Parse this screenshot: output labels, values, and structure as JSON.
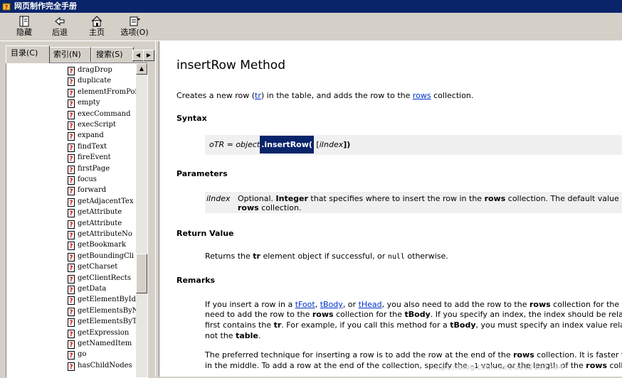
{
  "window": {
    "title": "网页制作完全手册"
  },
  "toolbar": {
    "buttons": [
      {
        "id": "hide",
        "label": "隐藏",
        "icon": "hide-pane-icon"
      },
      {
        "id": "back",
        "label": "后退",
        "icon": "back-arrow-icon"
      },
      {
        "id": "home",
        "label": "主页",
        "icon": "home-icon"
      },
      {
        "id": "options",
        "label": "选项(O)",
        "icon": "options-icon"
      }
    ]
  },
  "nav_tabs": [
    "目录(C)",
    "索引(N)",
    "搜索(S)"
  ],
  "tree": {
    "items": [
      "dragDrop",
      "duplicate",
      "elementFromPoi",
      "empty",
      "execCommand",
      "execScript",
      "expand",
      "findText",
      "fireEvent",
      "firstPage",
      "focus",
      "forward",
      "getAdjacentTex",
      "getAttribute",
      "getAttribute",
      "getAttributeNo",
      "getBookmark",
      "getBoundingCli",
      "getCharset",
      "getClientRects",
      "getData",
      "getElementById",
      "getElementsByN",
      "getElementsByT",
      "getExpression",
      "getNamedItem",
      "go",
      "hasChildNodes"
    ]
  },
  "content": {
    "title": "insertRow Method",
    "intro": {
      "a": "Creates a new row (",
      "link1": "tr",
      "b": ") in the table, and adds the row to the ",
      "link2": "rows",
      "c": " collection."
    },
    "syntax_heading": "Syntax",
    "syntax": {
      "a": "oTR = ",
      "obj": "object",
      "method": ".insertRow(",
      "b": " [",
      "param": "iIndex",
      "c": "])"
    },
    "parameters_heading": "Parameters",
    "param": {
      "name": "iIndex",
      "d1": "Optional. ",
      "type": "Integer",
      "d2": " that specifies where to insert the row in the ",
      "rows": "rows",
      "d3": " collection. The default value i",
      "line2_rows": "rows",
      "line2": " collection."
    },
    "return_heading": "Return Value",
    "return": {
      "a": "Returns the ",
      "tr": "tr",
      "b": " element object if successful, or ",
      "null": "null",
      "c": " otherwise."
    },
    "remarks_heading": "Remarks",
    "r1": {
      "a": "If you insert a row in a ",
      "tfoot": "tFoot",
      "b": ", ",
      "tbody": "tBody",
      "c": ", or ",
      "thead": "tHead",
      "d": ", you also need to add the row to the ",
      "rows": "rows",
      "e": " collection for the "
    },
    "r2": {
      "a": "need to add the row to the ",
      "rows": "rows",
      "b": " collection for the ",
      "tbody": "tBody",
      "c": ". If you specify an index, the index should be rela"
    },
    "r3": {
      "a": "first contains the ",
      "tr": "tr",
      "b": ". For example, if you call this method for a ",
      "tbody": "tBody",
      "c": ", you must specify an index value rela"
    },
    "r4": {
      "a": "not the ",
      "table": "table",
      "b": "."
    },
    "r5": {
      "a": "The preferred technique for inserting a row is to add the row at the end of the ",
      "rows": "rows",
      "b": " collection. It is faster t"
    },
    "r6": {
      "a": "in the middle. To add a row at the end of the collection, specify the ",
      "val": "-1",
      "b": " value, or the length of the ",
      "rows": "rows",
      "c": " coll"
    },
    "watermark": "https://blog.csdn.net/u012131784"
  },
  "colors": {
    "titlebar": "#0a246a",
    "link": "#0033cc",
    "highlight": "#0a246a",
    "panel": "#d4d0c8"
  }
}
